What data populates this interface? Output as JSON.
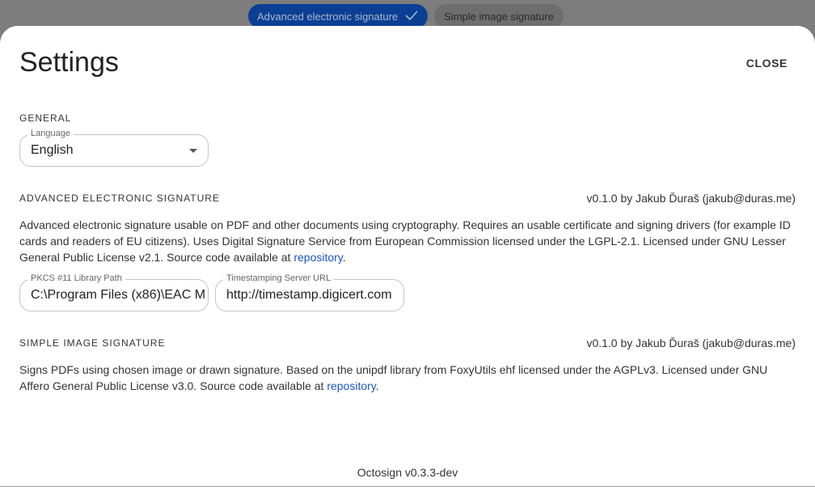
{
  "tabs": [
    {
      "label": "Advanced electronic signature",
      "selected": true,
      "icon": "check-icon"
    },
    {
      "label": "Simple image signature",
      "selected": false
    }
  ],
  "dialog": {
    "title": "Settings",
    "close_label": "CLOSE"
  },
  "general": {
    "heading": "GENERAL",
    "language_label": "Language",
    "language_value": "English"
  },
  "aes": {
    "heading": "ADVANCED ELECTRONIC SIGNATURE",
    "version": "v0.1.0 by Jakub Ďuraš (jakub@duras.me)",
    "description": "Advanced electronic signature usable on PDF and other documents using cryptography. Requires an usable certificate and signing drivers (for example ID cards and readers of EU citizens). Uses Digital Signature Service from European Commission licensed under the LGPL-2.1. Licensed under GNU Lesser General Public License v2.1. Source code available at ",
    "link": "repository",
    "suffix": ".",
    "pkcs_label": "PKCS #11 Library Path",
    "pkcs_value": "C:\\Program Files (x86)\\EAC M",
    "tsa_label": "Timestamping Server URL",
    "tsa_value": "http://timestamp.digicert.com"
  },
  "sis": {
    "heading": "SIMPLE IMAGE SIGNATURE",
    "version": "v0.1.0 by Jakub Ďuraš (jakub@duras.me)",
    "description": "Signs PDFs using chosen image or drawn signature. Based on the unipdf library from FoxyUtils ehf licensed under the AGPLv3. Licensed under GNU Affero General Public License v3.0. Source code available at ",
    "link": "repository",
    "suffix": "."
  },
  "footer": "Octosign v0.3.3-dev"
}
